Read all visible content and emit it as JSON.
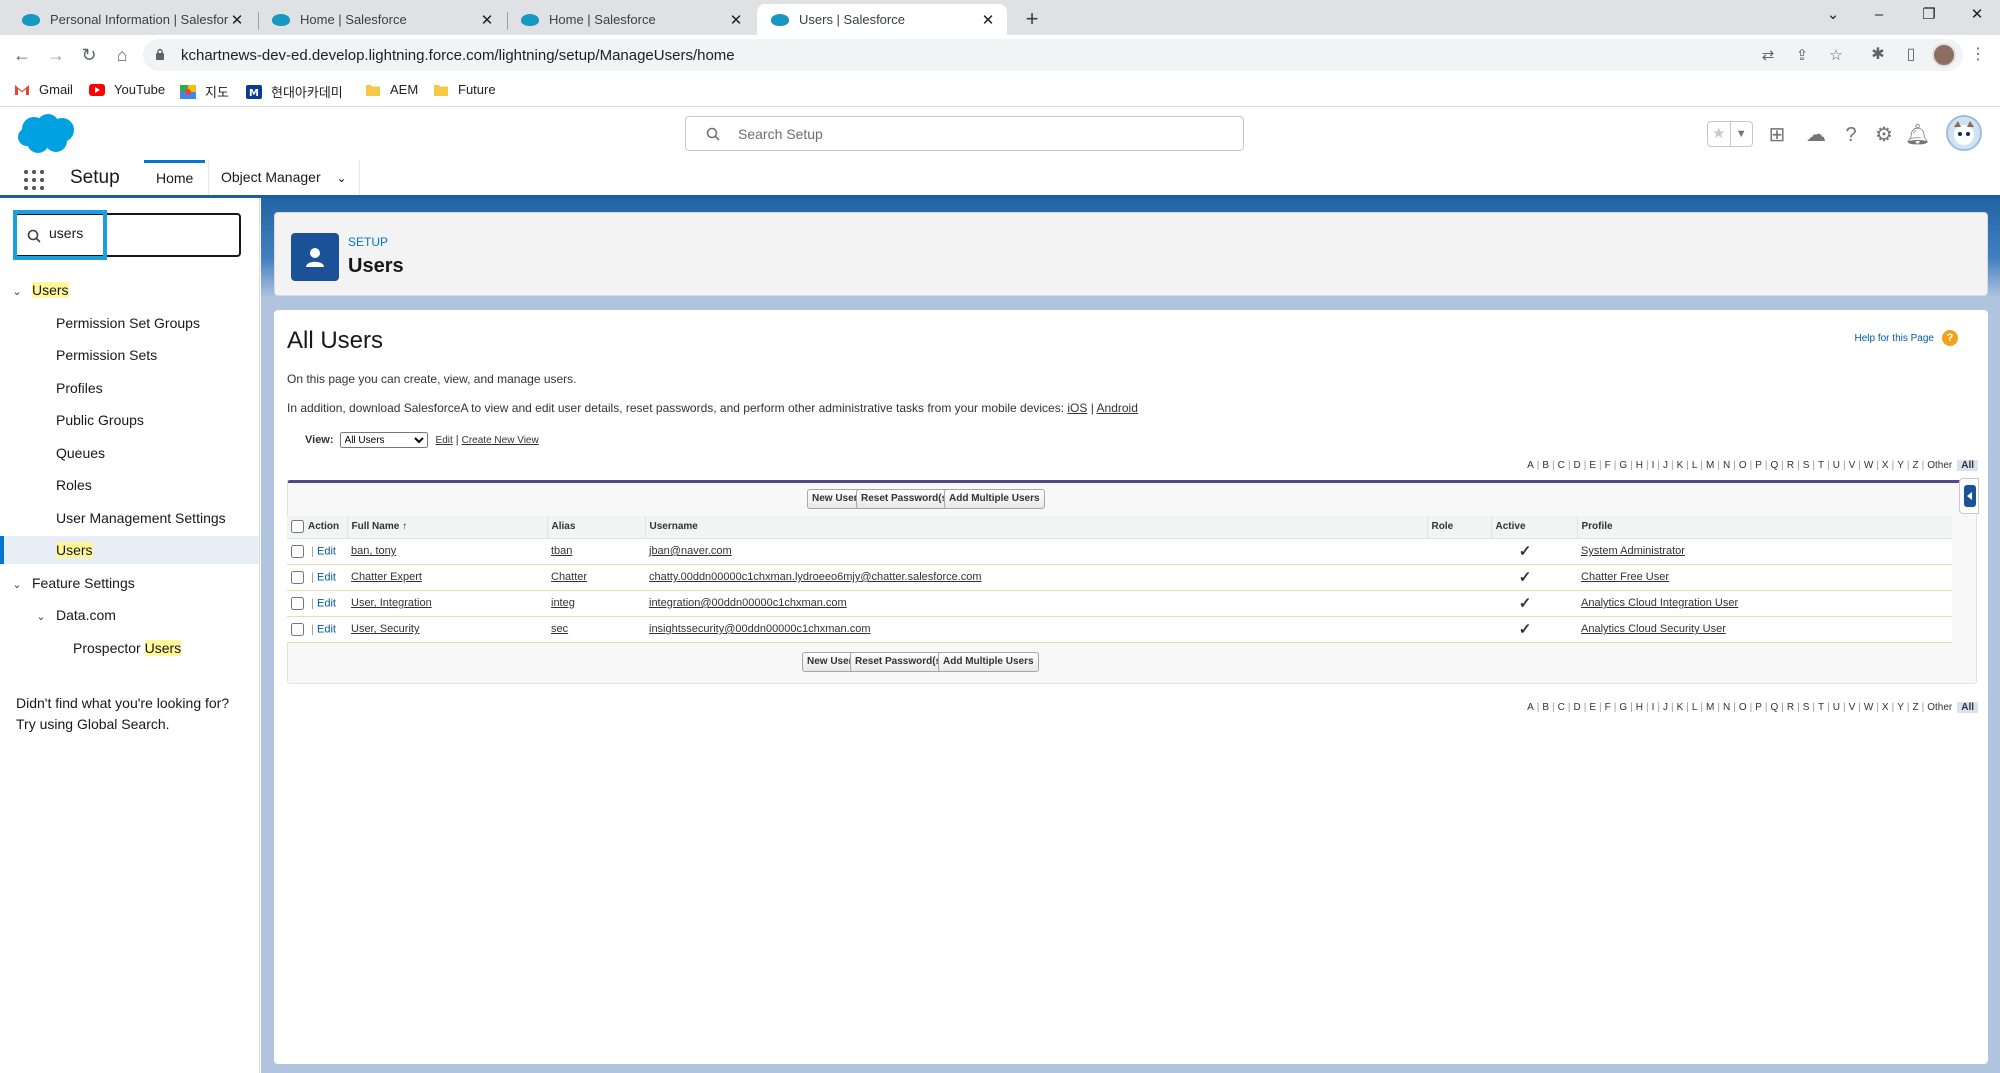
{
  "browser": {
    "tabs": [
      {
        "title": "Personal Information | Salesforce",
        "active": false
      },
      {
        "title": "Home | Salesforce",
        "active": false
      },
      {
        "title": "Home | Salesforce",
        "active": false
      },
      {
        "title": "Users | Salesforce",
        "active": true
      }
    ],
    "url": "kchartnews-dev-ed.develop.lightning.force.com/lightning/setup/ManageUsers/home",
    "bookmarks": [
      {
        "label": "Gmail",
        "icon": "gmail-icon"
      },
      {
        "label": "YouTube",
        "icon": "youtube-icon"
      },
      {
        "label": "지도",
        "icon": "maps-icon"
      },
      {
        "label": "현대아카데미",
        "icon": "m-icon"
      },
      {
        "label": "AEM",
        "icon": "folder-icon"
      },
      {
        "label": "Future",
        "icon": "folder-icon"
      }
    ]
  },
  "header": {
    "search_placeholder": "Search Setup"
  },
  "context_bar": {
    "app_name": "Setup",
    "tabs": [
      "Home",
      "Object Manager"
    ]
  },
  "sidebar": {
    "quick_find_value": "users",
    "tree": [
      {
        "label": "Users",
        "level": 0,
        "expanded": true,
        "highlight": true
      },
      {
        "label": "Permission Set Groups",
        "level": 1
      },
      {
        "label": "Permission Sets",
        "level": 1
      },
      {
        "label": "Profiles",
        "level": 1
      },
      {
        "label": "Public Groups",
        "level": 1
      },
      {
        "label": "Queues",
        "level": 1
      },
      {
        "label": "Roles",
        "level": 1
      },
      {
        "label": "User Management Settings",
        "level": 1
      },
      {
        "label": "Users",
        "level": 1,
        "selected": true,
        "highlight": true
      },
      {
        "label": "Feature Settings",
        "level": 0,
        "expanded": true
      },
      {
        "label": "Data.com",
        "level": 1,
        "expanded": true
      },
      {
        "label": "Prospector ",
        "highlight_suffix": "Users",
        "level": 2
      }
    ],
    "not_found_line1": "Didn't find what you're looking for?",
    "not_found_line2": "Try using Global Search."
  },
  "page_header": {
    "eyebrow": "SETUP",
    "title": "Users"
  },
  "content": {
    "title": "All Users",
    "help_link": "Help for this Page",
    "desc1": "On this page you can create, view, and manage users.",
    "desc2": "In addition, download SalesforceA to view and edit user details, reset passwords, and perform other administrative tasks from your mobile devices: ",
    "desc2_ios": "iOS",
    "desc2_sep": " | ",
    "desc2_android": "Android",
    "view_label": "View:",
    "view_selected": "All Users",
    "view_edit": "Edit",
    "view_create": "Create New View",
    "alpha": [
      "A",
      "B",
      "C",
      "D",
      "E",
      "F",
      "G",
      "H",
      "I",
      "J",
      "K",
      "L",
      "M",
      "N",
      "O",
      "P",
      "Q",
      "R",
      "S",
      "T",
      "U",
      "V",
      "W",
      "X",
      "Y",
      "Z",
      "Other",
      "All"
    ],
    "buttons": {
      "new_user": "New User",
      "reset_password": "Reset Password(s)",
      "add_multiple": "Add Multiple Users"
    },
    "columns": [
      "Action",
      "Full Name ↑",
      "Alias",
      "Username",
      "Role",
      "Active",
      "Profile"
    ],
    "edit_label": "Edit",
    "rows": [
      {
        "full_name": "ban, tony",
        "alias": "tban",
        "username": "jban@naver.com",
        "role": "",
        "active": "✓",
        "profile": "System Administrator"
      },
      {
        "full_name": "Chatter Expert",
        "alias": "Chatter",
        "username": "chatty.00ddn00000c1chxman.lydroeeo6mjy@chatter.salesforce.com",
        "role": "",
        "active": "✓",
        "profile": "Chatter Free User"
      },
      {
        "full_name": "User, Integration",
        "alias": "integ",
        "username": "integration@00ddn00000c1chxman.com",
        "role": "",
        "active": "✓",
        "profile": "Analytics Cloud Integration User"
      },
      {
        "full_name": "User, Security",
        "alias": "sec",
        "username": "insightssecurity@00ddn00000c1chxman.com",
        "role": "",
        "active": "✓",
        "profile": "Analytics Cloud Security User"
      }
    ]
  },
  "colors": {
    "brand": "#0176d3",
    "header_band": "#1b5ea0",
    "search_highlight": "#1aa0e0",
    "match_highlight": "#fff799"
  }
}
